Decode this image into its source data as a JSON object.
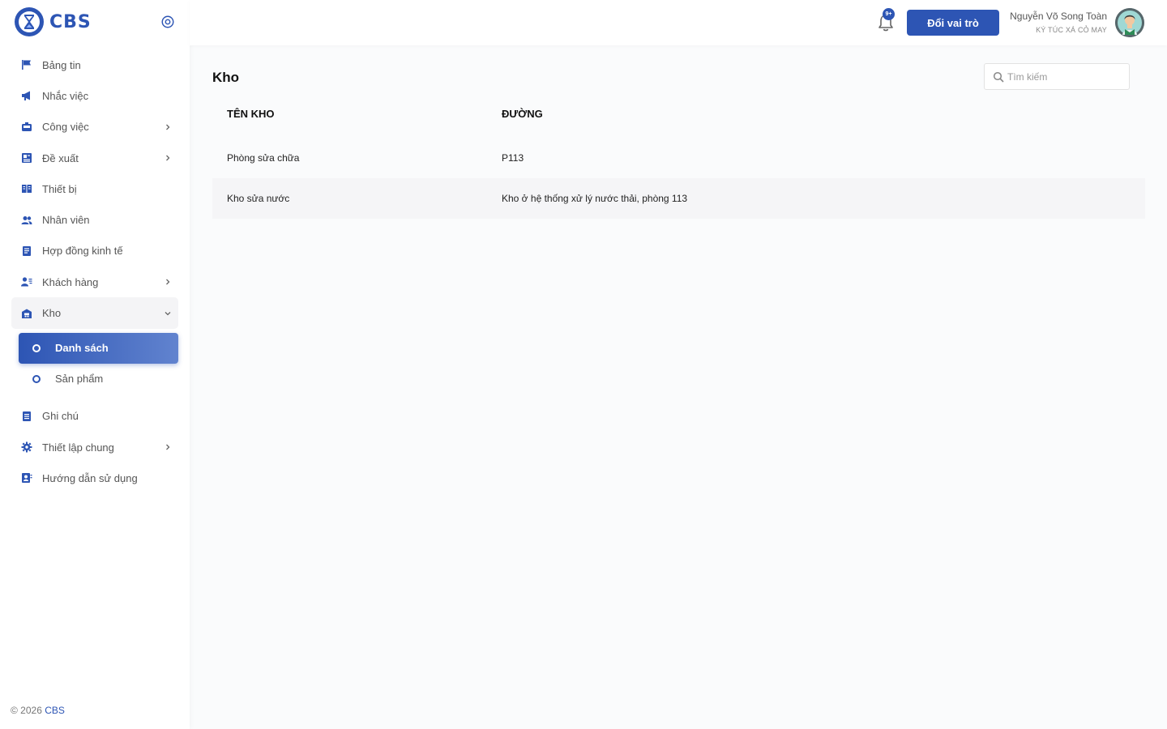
{
  "brand": {
    "name": "CBS"
  },
  "sidebar": {
    "items": [
      {
        "label": "Bảng tin",
        "icon": "flag-icon",
        "has_children": false
      },
      {
        "label": "Nhắc việc",
        "icon": "megaphone-icon",
        "has_children": false
      },
      {
        "label": "Công việc",
        "icon": "briefcase-icon",
        "has_children": true
      },
      {
        "label": "Đề xuất",
        "icon": "newspaper-icon",
        "has_children": true
      },
      {
        "label": "Thiết bị",
        "icon": "book-icon",
        "has_children": false
      },
      {
        "label": "Nhân viên",
        "icon": "users-icon",
        "has_children": false
      },
      {
        "label": "Hợp đồng kinh tế",
        "icon": "contract-icon",
        "has_children": false
      },
      {
        "label": "Khách hàng",
        "icon": "user-list-icon",
        "has_children": true
      },
      {
        "label": "Kho",
        "icon": "warehouse-icon",
        "has_children": true,
        "expanded": true,
        "children": [
          {
            "label": "Danh sách",
            "active": true
          },
          {
            "label": "Sản phẩm",
            "active": false
          }
        ]
      },
      {
        "label": "Ghi chú",
        "icon": "note-icon",
        "has_children": false
      },
      {
        "label": "Thiết lập chung",
        "icon": "gear-icon",
        "has_children": true
      },
      {
        "label": "Hướng dẫn sử dụng",
        "icon": "guide-icon",
        "has_children": false
      }
    ],
    "copyright_prefix": "© 2026",
    "copyright_brand": "CBS"
  },
  "header": {
    "notification_badge": "9+",
    "role_button": "Đổi vai trò",
    "user_name": "Nguyễn Võ Song Toàn",
    "user_org": "KÝ TÚC XÁ CỎ MAY"
  },
  "main": {
    "title": "Kho",
    "search_placeholder": "Tìm kiếm",
    "table": {
      "columns": [
        "TÊN KHO",
        "ĐƯỜNG"
      ],
      "rows": [
        [
          "Phòng sửa chữa",
          "P113"
        ],
        [
          "Kho sửa nước",
          "Kho ở hệ thống xử lý nước thải, phòng 113"
        ]
      ]
    }
  },
  "colors": {
    "accent": "#2d55b4"
  }
}
